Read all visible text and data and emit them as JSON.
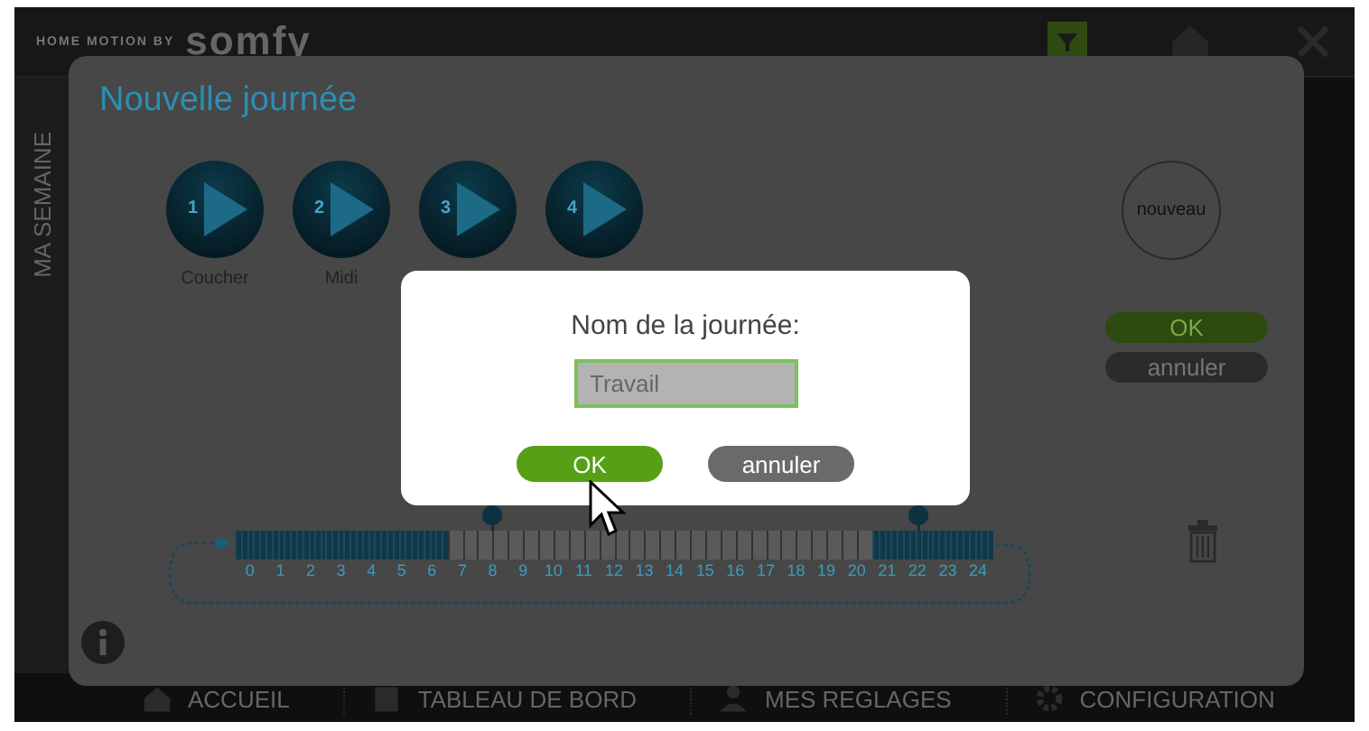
{
  "header": {
    "tagline": "HOME MOTION BY",
    "logo": "somfy"
  },
  "sidebar": {
    "label": "MA SEMAINE"
  },
  "nav": [
    {
      "label": "ACCUEIL",
      "kind": "home"
    },
    {
      "label": "TABLEAU DE BORD",
      "kind": "board"
    },
    {
      "label": "MES REGLAGES",
      "kind": "person"
    },
    {
      "label": "CONFIGURATION",
      "kind": "gear"
    }
  ],
  "panel": {
    "title": "Nouvelle journée",
    "presets": [
      {
        "number": "1",
        "label": "Coucher"
      },
      {
        "number": "2",
        "label": "Midi"
      },
      {
        "number": "3"
      },
      {
        "number": "4"
      }
    ],
    "new_button": "nouveau",
    "ok_button": "OK",
    "cancel_button": "annuler",
    "timeline": {
      "hours": [
        {
          "label": "0",
          "active": true,
          "pin": false
        },
        {
          "label": "1",
          "active": true,
          "pin": false
        },
        {
          "label": "2",
          "active": true,
          "pin": false
        },
        {
          "label": "3",
          "active": true,
          "pin": false
        },
        {
          "label": "4",
          "active": true,
          "pin": false
        },
        {
          "label": "5",
          "active": true,
          "pin": false
        },
        {
          "label": "6",
          "active": true,
          "pin": false
        },
        {
          "label": "7",
          "active": false,
          "pin": false
        },
        {
          "label": "8",
          "active": false,
          "pin": true
        },
        {
          "label": "9",
          "active": false,
          "pin": false
        },
        {
          "label": "10",
          "active": false,
          "pin": false
        },
        {
          "label": "11",
          "active": false,
          "pin": false
        },
        {
          "label": "12",
          "active": false,
          "pin": false
        },
        {
          "label": "13",
          "active": false,
          "pin": false
        },
        {
          "label": "14",
          "active": false,
          "pin": false
        },
        {
          "label": "15",
          "active": false,
          "pin": false
        },
        {
          "label": "16",
          "active": false,
          "pin": false
        },
        {
          "label": "17",
          "active": false,
          "pin": false
        },
        {
          "label": "18",
          "active": false,
          "pin": false
        },
        {
          "label": "19",
          "active": false,
          "pin": false
        },
        {
          "label": "20",
          "active": false,
          "pin": false
        },
        {
          "label": "21",
          "active": true,
          "pin": false
        },
        {
          "label": "22",
          "active": true,
          "pin": true
        },
        {
          "label": "23",
          "active": true,
          "pin": false
        },
        {
          "label": "24",
          "active": true,
          "pin": false
        }
      ]
    }
  },
  "dialog": {
    "label": "Nom de la journée:",
    "value": "Travail",
    "ok_button": "OK",
    "cancel_button": "annuler"
  }
}
